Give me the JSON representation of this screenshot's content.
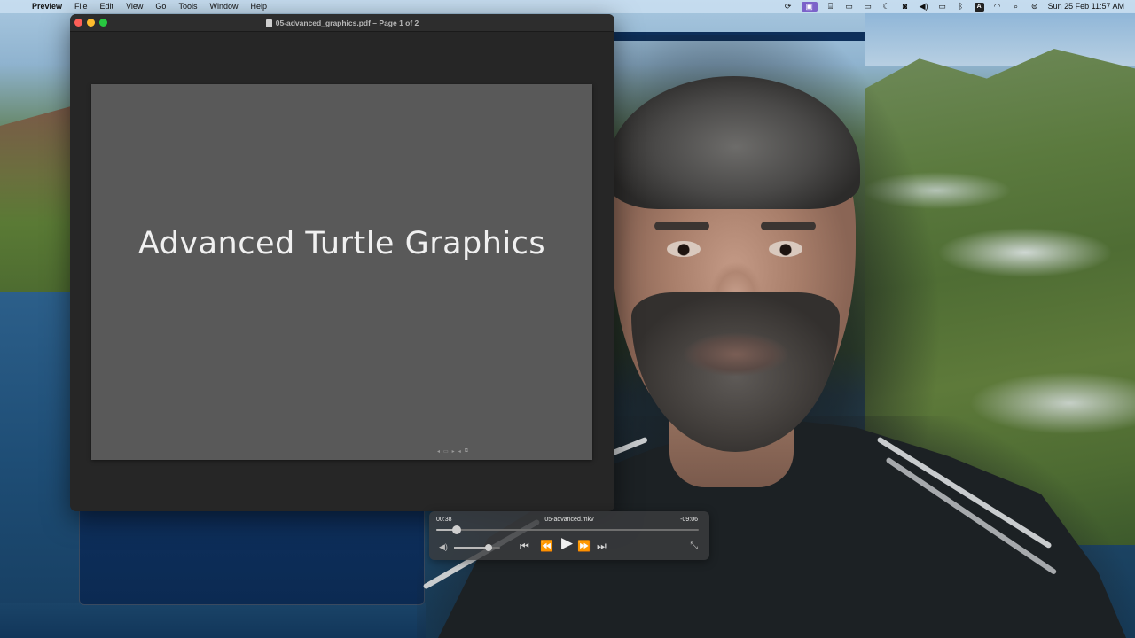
{
  "menubar": {
    "apple_glyph": "",
    "app_name": "Preview",
    "items": [
      "File",
      "Edit",
      "View",
      "Go",
      "Tools",
      "Window",
      "Help"
    ],
    "keyboard_input": "A",
    "clock": "Sun 25 Feb  11:57 AM"
  },
  "preview_window": {
    "title": "05-advanced_graphics.pdf – Page 1 of 2",
    "slide_title": "Advanced Turtle Graphics"
  },
  "player": {
    "elapsed": "00:38",
    "file_name": "05-advanced.mkv",
    "remaining": "-09:06",
    "seek_progress": 0.077,
    "volume_level": 0.75
  }
}
